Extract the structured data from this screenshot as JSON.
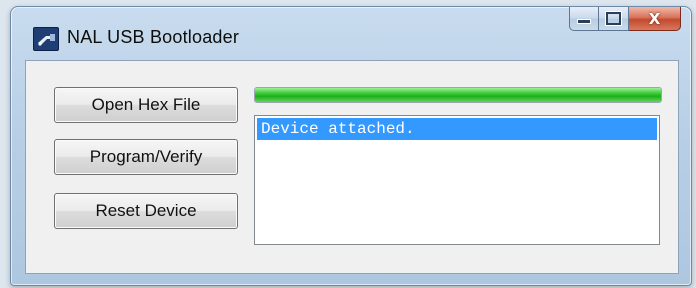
{
  "window": {
    "title": "NAL USB Bootloader",
    "icon": "usb-device-icon",
    "caption_buttons": {
      "minimize_icon": "minimize-icon",
      "maximize_icon": "maximize-icon",
      "close_label": "X"
    }
  },
  "buttons": {
    "open_hex_file": "Open Hex File",
    "program_verify": "Program/Verify",
    "reset_device": "Reset Device"
  },
  "progress": {
    "value_percent": 100,
    "color": "#37c832"
  },
  "log": {
    "items": [
      {
        "text": "Device attached.",
        "selected": true
      }
    ],
    "selection_color": "#3399ff"
  }
}
